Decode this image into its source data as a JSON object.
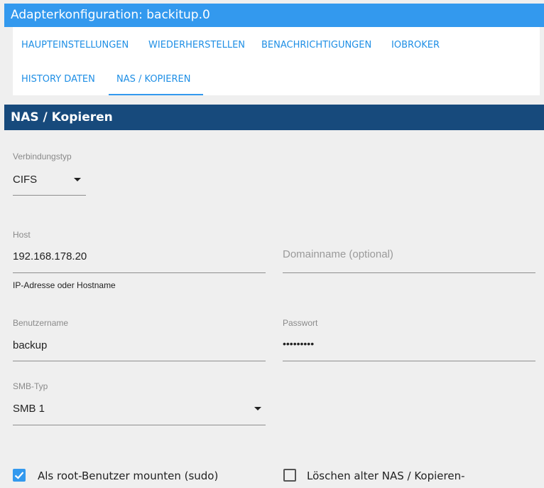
{
  "window": {
    "title": "Adapterkonfiguration: backitup.0"
  },
  "tabs": [
    {
      "label": "HAUPTEINSTELLUNGEN"
    },
    {
      "label": "WIEDERHERSTELLEN"
    },
    {
      "label": "BENACHRICHTIGUNGEN"
    },
    {
      "label": "IOBROKER"
    },
    {
      "label": "HISTORY DATEN"
    },
    {
      "label": "NAS / KOPIEREN",
      "active": true
    }
  ],
  "section": {
    "title": "NAS / Kopieren"
  },
  "form": {
    "connection_type": {
      "label": "Verbindungstyp",
      "value": "CIFS"
    },
    "host": {
      "label": "Host",
      "value": "192.168.178.20",
      "helper": "IP-Adresse oder Hostname"
    },
    "domain": {
      "placeholder": "Domainname (optional)"
    },
    "username": {
      "label": "Benutzername",
      "value": "backup"
    },
    "password": {
      "label": "Passwort",
      "value": "•••••••••"
    },
    "smb_type": {
      "label": "SMB-Typ",
      "value": "SMB 1"
    },
    "root_mount": {
      "label": "Als root-Benutzer mounten (sudo)",
      "checked": true
    },
    "delete_old": {
      "label": "Löschen alter NAS / Kopieren-",
      "checked": false
    }
  },
  "colors": {
    "accent": "#3399ee",
    "section": "#174a7c",
    "background": "#efefef"
  },
  "icons": {
    "select_caret": "chevron-down-icon",
    "check": "check-icon"
  }
}
